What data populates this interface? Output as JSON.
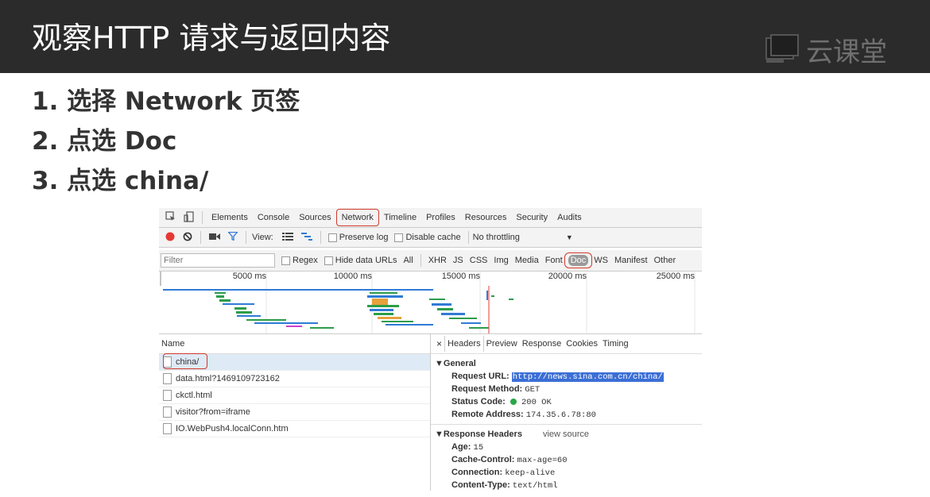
{
  "slide": {
    "title": "观察HTTP 请求与返回内容",
    "brand": "云课堂",
    "steps": [
      "1.  选择 Network 页签",
      "2.  点选 Doc",
      "3.  点选 china/"
    ]
  },
  "devtools": {
    "main_tabs": [
      "Elements",
      "Console",
      "Sources",
      "Network",
      "Timeline",
      "Profiles",
      "Resources",
      "Security",
      "Audits"
    ],
    "toolbar": {
      "view_label": "View:",
      "preserve_log": "Preserve log",
      "disable_cache": "Disable cache",
      "throttling": "No throttling"
    },
    "filter": {
      "placeholder": "Filter",
      "regex": "Regex",
      "hide_data_urls": "Hide data URLs",
      "types": [
        "All",
        "XHR",
        "JS",
        "CSS",
        "Img",
        "Media",
        "Font",
        "Doc",
        "WS",
        "Manifest",
        "Other"
      ]
    },
    "timeline_ticks": [
      "5000 ms",
      "10000 ms",
      "15000 ms",
      "20000 ms",
      "25000 ms"
    ],
    "name_header": "Name",
    "requests": [
      "china/",
      "data.html?1469109723162",
      "ckctl.html",
      "visitor?from=iframe",
      "IO.WebPush4.localConn.htm"
    ],
    "detail_tabs": [
      "×",
      "Headers",
      "Preview",
      "Response",
      "Cookies",
      "Timing"
    ],
    "general": {
      "heading": "▼General",
      "request_url_label": "Request URL:",
      "request_url": "http://news.sina.com.cn/china/",
      "method_label": "Request Method:",
      "method": "GET",
      "status_label": "Status Code:",
      "status": "200 OK",
      "remote_label": "Remote Address:",
      "remote": "174.35.6.78:80"
    },
    "response_headers": {
      "heading": "▼Response Headers",
      "view_source": "view source",
      "age_label": "Age:",
      "age": "15",
      "cache_label": "Cache-Control:",
      "cache": "max-age=60",
      "connection_label": "Connection:",
      "connection": "keep-alive",
      "content_type_label": "Content-Type:",
      "content_type": "text/html"
    }
  },
  "colors": {
    "accent_red": "#d0392b",
    "record_red": "#e53935",
    "status_green": "#28a745",
    "selection_blue": "#3b6fd6"
  }
}
